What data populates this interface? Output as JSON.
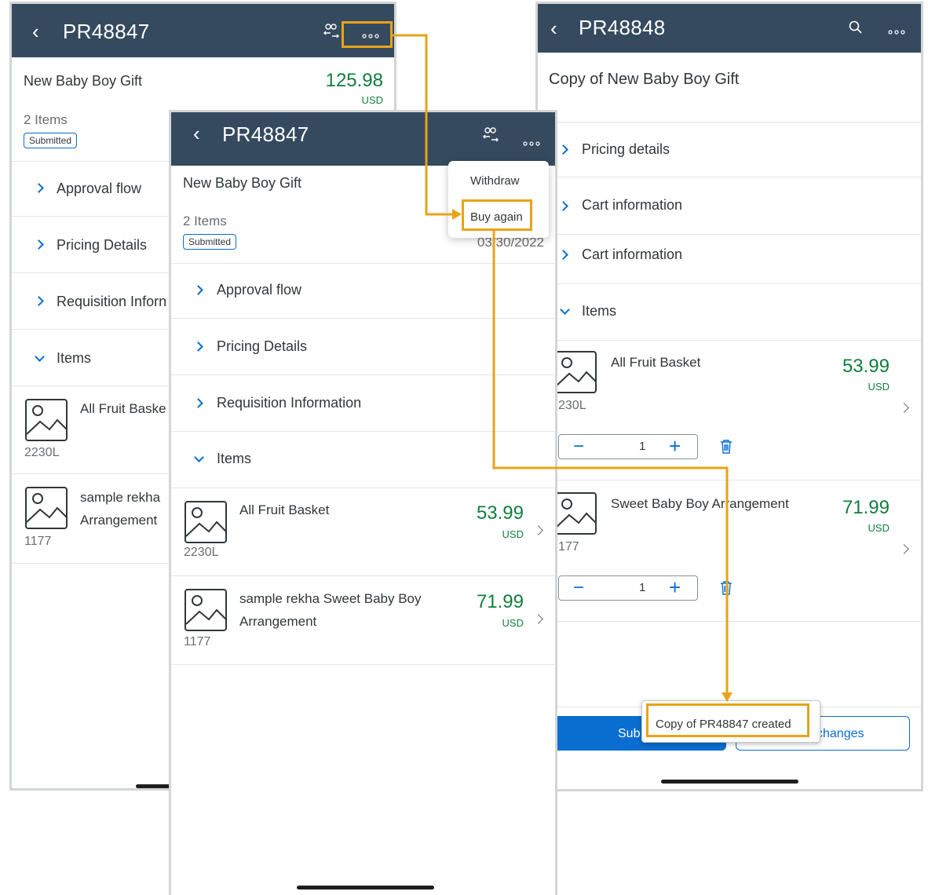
{
  "screen1": {
    "title": "PR48847",
    "desc": "New Baby Boy Gift",
    "total": "125.98",
    "currency": "USD",
    "items_count": "2 Items",
    "status": "Submitted",
    "sections": [
      "Approval flow",
      "Pricing Details",
      "Requisition Inforn",
      "Items"
    ],
    "items": [
      {
        "name": "All Fruit Baske",
        "code": "2230L"
      },
      {
        "name": "sample rekha",
        "name2": "Arrangement",
        "code": "1177"
      }
    ]
  },
  "screen2": {
    "title": "PR48847",
    "desc": "New Baby Boy Gift",
    "items_count": "2 Items",
    "status": "Submitted",
    "date": "03/30/2022",
    "menu": [
      "Withdraw",
      "Buy again"
    ],
    "sections": [
      "Approval flow",
      "Pricing Details",
      "Requisition Information",
      "Items"
    ],
    "items": [
      {
        "name": "All Fruit Basket",
        "code": "2230L",
        "price": "53.99",
        "currency": "USD"
      },
      {
        "name": "sample rekha Sweet Baby Boy",
        "name2": "Arrangement",
        "code": "1177",
        "price": "71.99",
        "currency": "USD"
      }
    ]
  },
  "screen3": {
    "title": "PR48848",
    "desc": "Copy of New Baby Boy Gift",
    "sections": [
      "Pricing details",
      "Cart information",
      "Cart information",
      "Items"
    ],
    "items": [
      {
        "name": "All Fruit Basket",
        "code": "230L",
        "price": "53.99",
        "currency": "USD",
        "qty": "1"
      },
      {
        "name": "Sweet Baby Boy Arrangement",
        "code": "177",
        "price": "71.99",
        "currency": "USD",
        "qty": "1"
      }
    ],
    "submit_label": "Sub",
    "changes_label": "changes",
    "toast": "Copy of PR48847 created"
  },
  "colors": {
    "header": "#354a5f",
    "accent": "#0a6ed1",
    "price": "#107e3e",
    "highlight": "#e8a317"
  }
}
